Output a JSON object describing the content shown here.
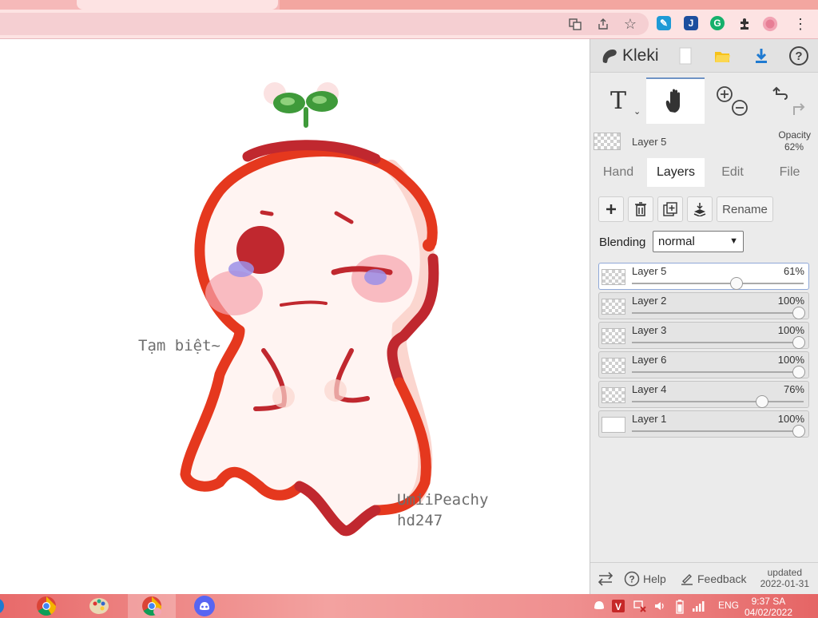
{
  "canvas": {
    "text_goodbye": "Tạm biệt~",
    "signature_line1": "UmiiPeachy",
    "signature_line2": "hd247"
  },
  "app": {
    "name": "Kleki",
    "current_layer_name": "Layer 5",
    "opacity_label": "Opacity",
    "opacity_value": "62%"
  },
  "tabs": [
    {
      "label": "Hand"
    },
    {
      "label": "Layers"
    },
    {
      "label": "Edit"
    },
    {
      "label": "File"
    }
  ],
  "layers_panel": {
    "rename_label": "Rename",
    "blending_label": "Blending",
    "blending_value": "normal",
    "layers": [
      {
        "name": "Layer 5",
        "opacity_label": "61%",
        "opacity": 0.61,
        "selected": true
      },
      {
        "name": "Layer 2",
        "opacity_label": "100%",
        "opacity": 1.0,
        "selected": false
      },
      {
        "name": "Layer 3",
        "opacity_label": "100%",
        "opacity": 1.0,
        "selected": false
      },
      {
        "name": "Layer 6",
        "opacity_label": "100%",
        "opacity": 1.0,
        "selected": false
      },
      {
        "name": "Layer 4",
        "opacity_label": "76%",
        "opacity": 0.76,
        "selected": false
      },
      {
        "name": "Layer 1",
        "opacity_label": "100%",
        "opacity": 1.0,
        "selected": false
      }
    ]
  },
  "footer": {
    "help_label": "Help",
    "feedback_label": "Feedback",
    "updated_line1": "updated",
    "updated_line2": "2022-01-31"
  },
  "taskbar": {
    "language": "ENG",
    "time": "9:37 SA",
    "date": "04/02/2022"
  },
  "colors": {
    "accent": "#6f93c5",
    "ghost_outline": "#e5381e",
    "ghost_outline_dark": "#c0282f",
    "taskbar": "#ef8f8f"
  }
}
